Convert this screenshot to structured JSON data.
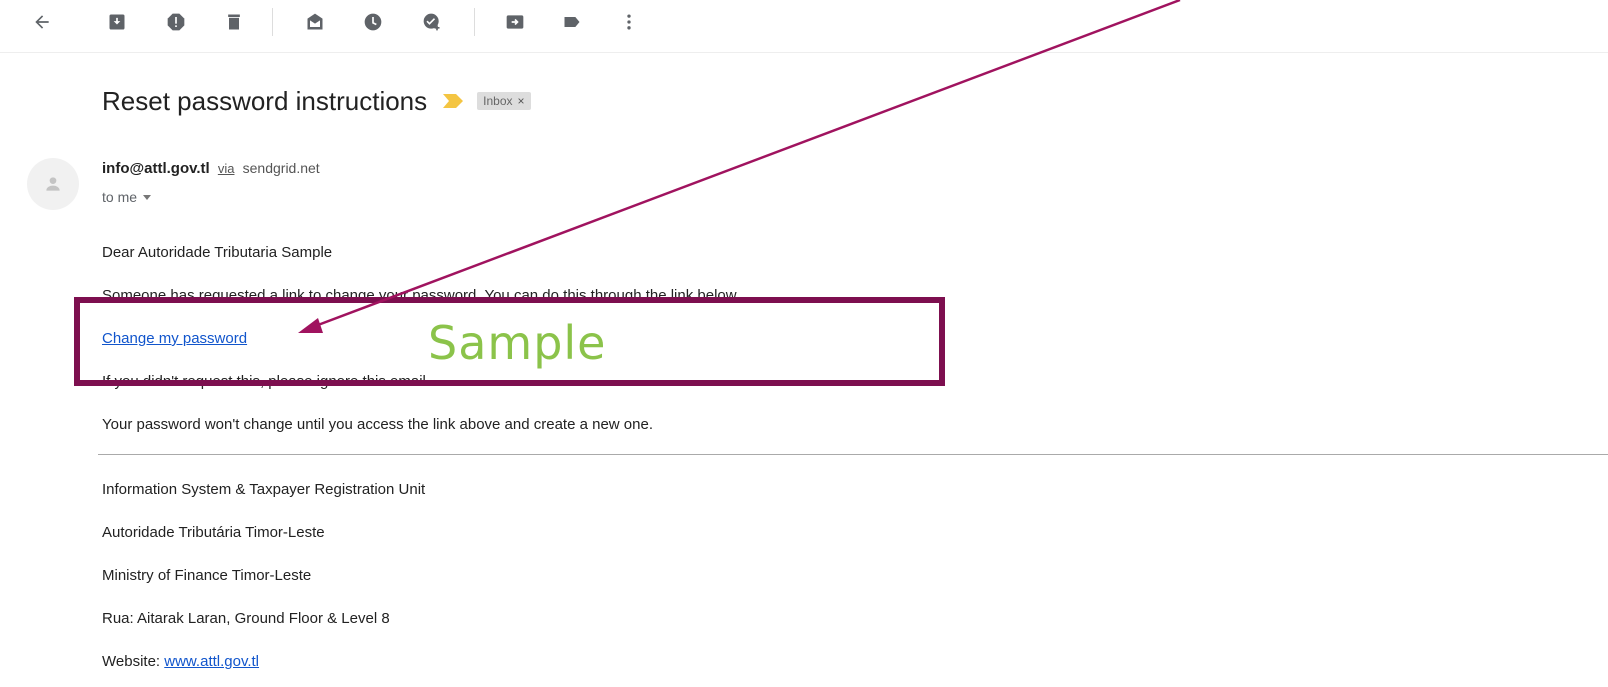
{
  "toolbar": {
    "icons": [
      {
        "name": "back-arrow-icon"
      },
      {
        "name": "archive-icon"
      },
      {
        "name": "report-spam-icon"
      },
      {
        "name": "delete-icon"
      },
      {
        "name": "mark-unread-icon"
      },
      {
        "name": "snooze-icon"
      },
      {
        "name": "add-to-tasks-icon"
      },
      {
        "name": "move-to-icon"
      },
      {
        "name": "labels-icon"
      },
      {
        "name": "more-vert-icon"
      }
    ]
  },
  "email": {
    "subject": "Reset password instructions",
    "label": "Inbox",
    "label_close": "×",
    "sender_email": "info@attl.gov.tl",
    "via": "via",
    "via_domain": "sendgrid.net",
    "to": "to me",
    "body": {
      "greeting": "Dear Autoridade Tributaria Sample",
      "line1": "Someone has requested a link to change your password. You can do this through the link below.",
      "link": "Change my password",
      "line2": "If you didn't request this, please ignore this email.",
      "line3": "Your password won't change until you access the link above and create a new one."
    },
    "signature": {
      "unit": "Information System & Taxpayer Registration Unit",
      "org": "Autoridade Tributária Timor-Leste",
      "ministry": "Ministry of Finance Timor-Leste",
      "address": "Rua: Aitarak Laran, Ground Floor & Level 8",
      "website_label": "Website:",
      "website_url": "www.attl.gov.tl"
    }
  },
  "annotation": {
    "label": "Sample",
    "box_color": "#7d0f4f",
    "arrow_color": "#a0135f",
    "label_color": "#8bc34a"
  },
  "colors": {
    "link": "#1155cc",
    "importance": "#f4c542",
    "icon": "#5f6368"
  }
}
